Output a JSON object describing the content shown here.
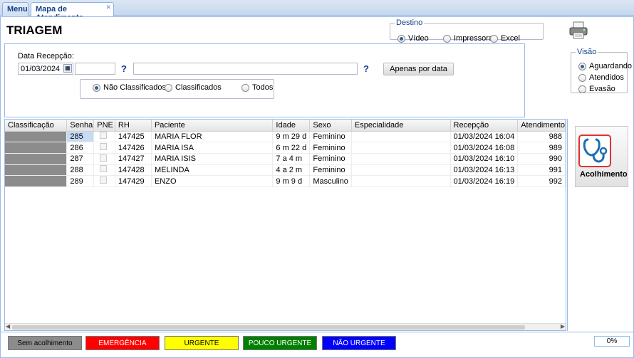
{
  "tabs": [
    {
      "label": "Menu",
      "active": false
    },
    {
      "label": "Mapa de Atendimento",
      "active": true,
      "closable": true
    }
  ],
  "page_title": "TRIAGEM",
  "destino": {
    "legend": "Destino",
    "options": [
      "Vídeo",
      "Impressora",
      "Excel"
    ],
    "selected": "Vídeo"
  },
  "filtros": {
    "data_label": "Data Recepção:",
    "data_value": "01/03/2024",
    "help_icon_text": "?",
    "apenas_btn": "Apenas por data",
    "classificacao_options": [
      "Não Classificados",
      "Classificados",
      "Todos"
    ],
    "classificacao_selected": "Não Classificados"
  },
  "visao": {
    "legend": "Visão",
    "options": [
      "Aguardando",
      "Atendidos",
      "Evasão"
    ],
    "selected": "Aguardando"
  },
  "grid": {
    "columns": [
      "Classificação",
      "Senha",
      "PNE",
      "RH",
      "Paciente",
      "Idade",
      "Sexo",
      "Especialidade",
      "Recepção",
      "Atendimento"
    ],
    "rows": [
      {
        "senha": "285",
        "pne": false,
        "rh": "147425",
        "paciente": "MARIA FLOR",
        "idade": "9 m 29 d",
        "sexo": "Feminino",
        "especialidade": "",
        "recepcao": "01/03/2024 16:04",
        "atendimento": "988"
      },
      {
        "senha": "286",
        "pne": false,
        "rh": "147426",
        "paciente": "MARIA ISA",
        "idade": "6 m 22 d",
        "sexo": "Feminino",
        "especialidade": "",
        "recepcao": "01/03/2024 16:08",
        "atendimento": "989"
      },
      {
        "senha": "287",
        "pne": false,
        "rh": "147427",
        "paciente": "MARIA ISIS",
        "idade": "7 a 4 m",
        "sexo": "Feminino",
        "especialidade": "",
        "recepcao": "01/03/2024 16:10",
        "atendimento": "990"
      },
      {
        "senha": "288",
        "pne": false,
        "rh": "147428",
        "paciente": "MELINDA",
        "idade": "4 a 2 m",
        "sexo": "Feminino",
        "especialidade": "",
        "recepcao": "01/03/2024 16:13",
        "atendimento": "991"
      },
      {
        "senha": "289",
        "pne": false,
        "rh": "147429",
        "paciente": "ENZO",
        "idade": "9 m 9 d",
        "sexo": "Masculino",
        "especialidade": "",
        "recepcao": "01/03/2024 16:19",
        "atendimento": "992"
      }
    ]
  },
  "acolhimento_btn": "Acolhimento",
  "legenda": [
    {
      "label": "Sem acolhimento",
      "bg": "#8c8c8c",
      "fg": "#000000"
    },
    {
      "label": "EMERGÊNCIA",
      "bg": "#ff0000",
      "fg": "#ffffff"
    },
    {
      "label": "URGENTE",
      "bg": "#ffff00",
      "fg": "#000000"
    },
    {
      "label": "POUCO URGENTE",
      "bg": "#008000",
      "fg": "#ffffff"
    },
    {
      "label": "NÃO URGENTE",
      "bg": "#0000ff",
      "fg": "#ffffff"
    }
  ],
  "progress": "0%",
  "colors": {
    "accent": "#15428b",
    "row_class": "#8c8c8c"
  }
}
